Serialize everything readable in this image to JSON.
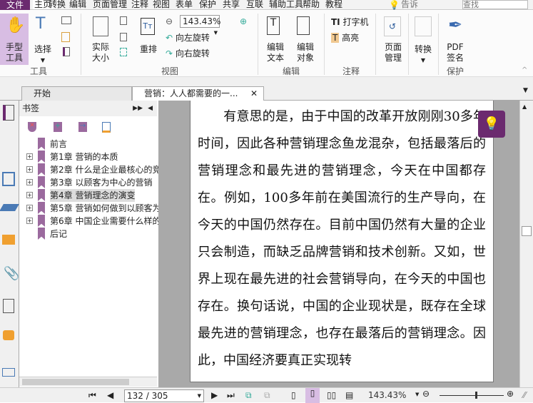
{
  "menu": {
    "file": "文件",
    "items": [
      "主页",
      "转换",
      "编辑",
      "页面管理",
      "注释",
      "视图",
      "表单",
      "保护",
      "共享",
      "互联",
      "辅助工具",
      "帮助",
      "教程"
    ],
    "tell": "告诉",
    "search_placeholder": "查找"
  },
  "ribbon": {
    "hand": "手型\n工具",
    "select": "选择",
    "actual": "实际\n大小",
    "reflow": "重排",
    "zoom": "143.43%",
    "rotate_left": "向左旋转",
    "rotate_right": "向右旋转",
    "edit_text": "编辑\n文本",
    "edit_object": "编辑\n对象",
    "typewriter": "打字机",
    "highlight": "高亮",
    "page_manage": "页面\n管理",
    "convert": "转换",
    "sign": "PDF\n签名",
    "groups": {
      "tools": "工具",
      "view": "视图",
      "edit": "编辑",
      "comment": "注释",
      "protect": "保护"
    }
  },
  "tabs": [
    "开始",
    "营销：人人都需要的一..."
  ],
  "bookmarks": {
    "title": "书签",
    "items": [
      {
        "label": "前言",
        "expand": false
      },
      {
        "label": "第1章 营销的本质",
        "expand": true
      },
      {
        "label": "第2章 什么是企业最核心的竞",
        "expand": true
      },
      {
        "label": "第3章 以顾客为中心的营销",
        "expand": true
      },
      {
        "label": "第4章 营销理念的演变",
        "expand": true,
        "selected": true
      },
      {
        "label": "第5章 营销如何做到以顾客为",
        "expand": true
      },
      {
        "label": "第6章 中国企业需要什么样的",
        "expand": true
      },
      {
        "label": "后记",
        "expand": false
      }
    ]
  },
  "document": {
    "text": "　　有意思的是，由于中国的改革开放刚刚30多年时间，因此各种营销理念鱼龙混杂，包括最落后的营销理念和最先进的营销理念，今天在中国都存在。例如，100多年前在美国流行的生产导向，在今天的中国仍然存在。目前中国仍然有大量的企业只会制造，而缺乏品牌营销和技术创新。又如，世界上现在最先进的社会营销导向，在今天的中国也存在。换句话说，中国的企业现状是，既存在全球最先进的营销理念，也存在最落后的营销理念。因此，中国经济要真正实现转"
  },
  "status": {
    "page": "132 / 305",
    "zoom": "143.43%",
    "zoom_slider": 0.55
  },
  "colors": {
    "accent": "#6b2a6f",
    "bookmark": "#9b6a9e"
  }
}
